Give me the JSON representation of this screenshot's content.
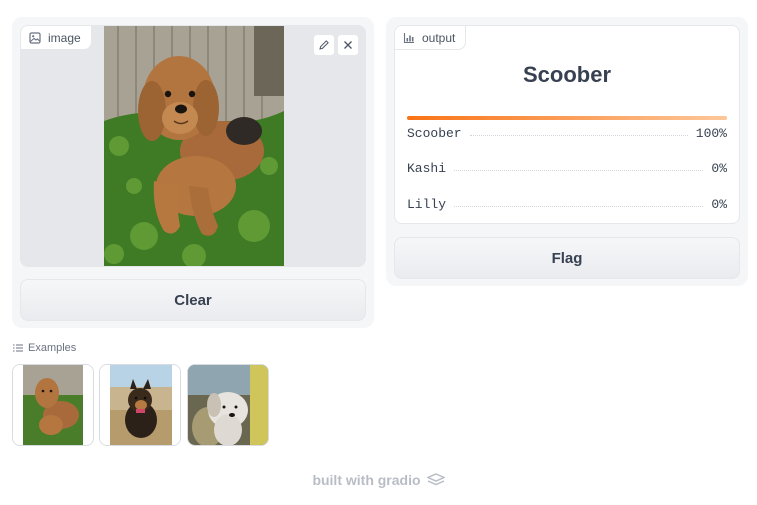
{
  "input": {
    "label": "image",
    "label_icon": "image-icon",
    "edit_icon": "pencil-icon",
    "clear_icon": "close-icon",
    "image_alt": "golden doodle dog lying on grass"
  },
  "clear_button": {
    "label": "Clear"
  },
  "output": {
    "label": "output",
    "label_icon": "bar-chart-icon",
    "predicted": "Scoober",
    "top_confidence": 1.0,
    "confidences": [
      {
        "name": "Scoober",
        "value": "100%"
      },
      {
        "name": "Kashi",
        "value": "0%"
      },
      {
        "name": "Lilly",
        "value": "0%"
      }
    ]
  },
  "flag_button": {
    "label": "Flag"
  },
  "examples": {
    "label": "Examples",
    "label_icon": "list-icon",
    "items": [
      "golden doodle on grass",
      "shepherd puppy on couch",
      "white puppy on patterned chair"
    ]
  },
  "footer": {
    "text": "built with gradio",
    "icon": "gradio-logo-icon"
  },
  "colors": {
    "accent": "#f97316",
    "panel_bg": "#f5f6f8",
    "border": "#e5e7eb"
  }
}
